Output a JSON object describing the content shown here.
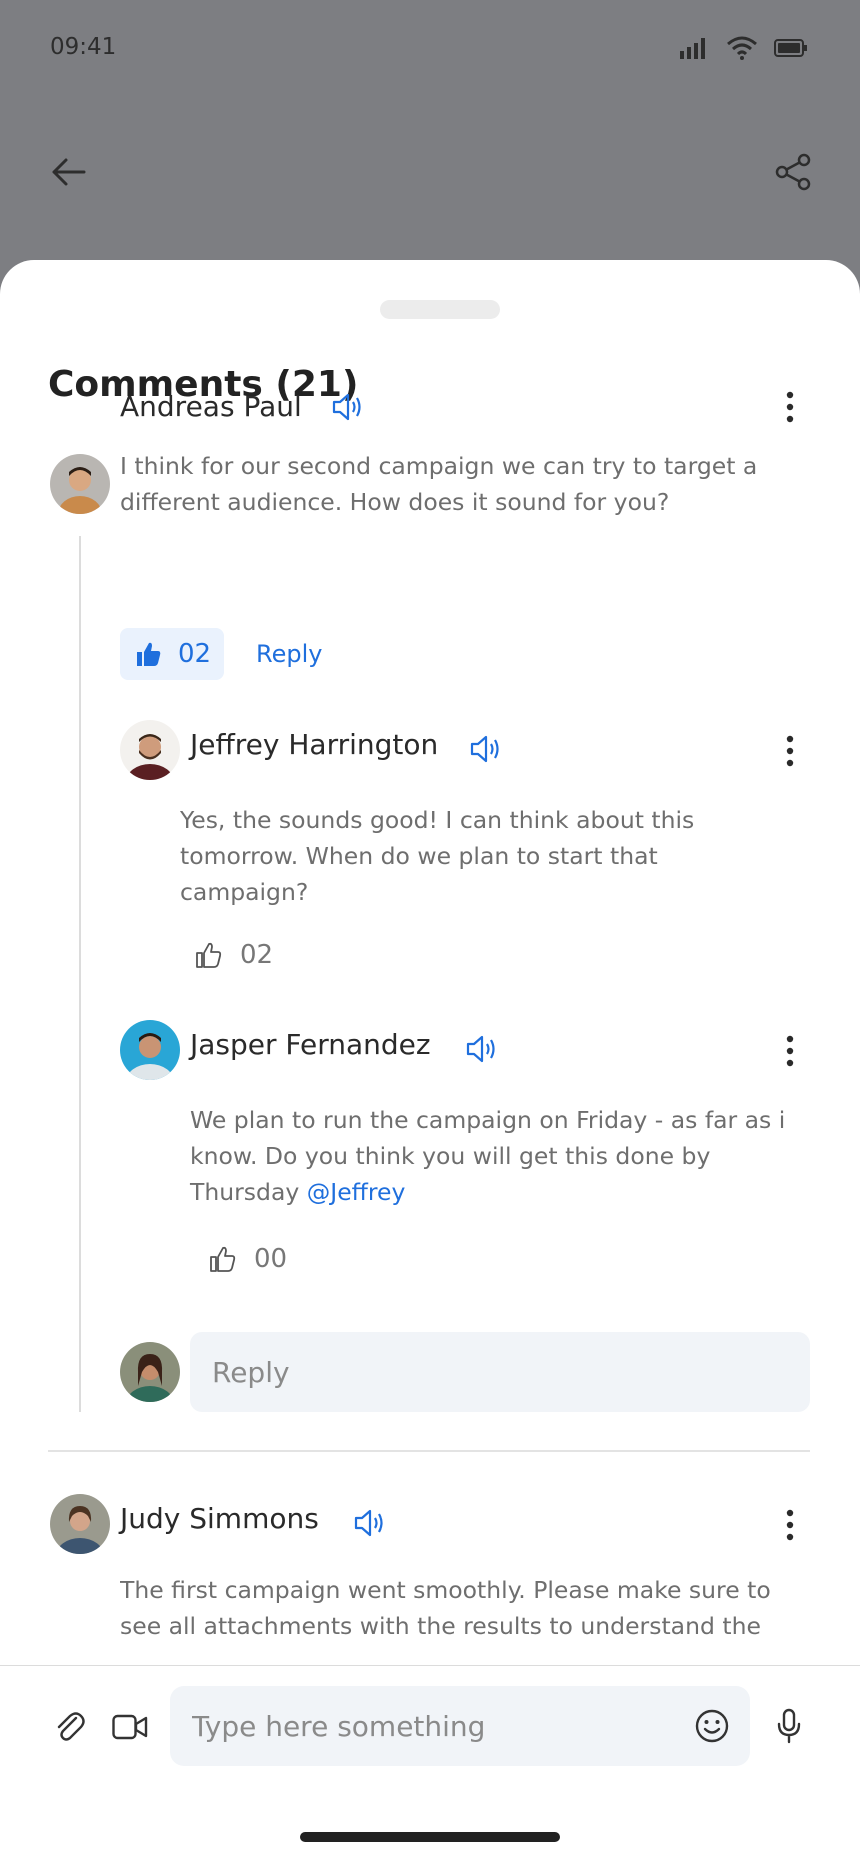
{
  "status": {
    "time": "09:41"
  },
  "sheet": {
    "title": "Comments (21)"
  },
  "comments": [
    {
      "author": "Andreas Paul",
      "text": "I think for our second campaign we can try to target a different audience. How does it sound for you?",
      "likes": "02",
      "reply_label": "Reply",
      "replies": [
        {
          "author": "Jeffrey Harrington",
          "text": "Yes, the sounds good! I can think about this tomorrow. When do we plan to start that campaign?",
          "likes": "02"
        },
        {
          "author": "Jasper Fernandez",
          "text": "We plan to run the campaign on Friday - as far as i know. Do you think you will get this done by Thursday",
          "mention": "@Jeffrey",
          "likes": "00"
        }
      ],
      "reply_input": {
        "placeholder": "Reply"
      }
    },
    {
      "author": "Judy Simmons",
      "text": "The first campaign went smoothly. Please make sure to see all attachments with the results to understand the"
    }
  ],
  "composer": {
    "placeholder": "Type here something"
  },
  "colors": {
    "accent": "#1f6fdd",
    "overlay": "#7d7e82",
    "field_bg": "#f1f4f8"
  },
  "icons": [
    "signal-icon",
    "wifi-icon",
    "battery-icon",
    "back-arrow-icon",
    "share-icon",
    "speaker-icon",
    "more-icon",
    "thumbs-up-icon",
    "paperclip-icon",
    "video-icon",
    "emoji-icon",
    "microphone-icon"
  ]
}
